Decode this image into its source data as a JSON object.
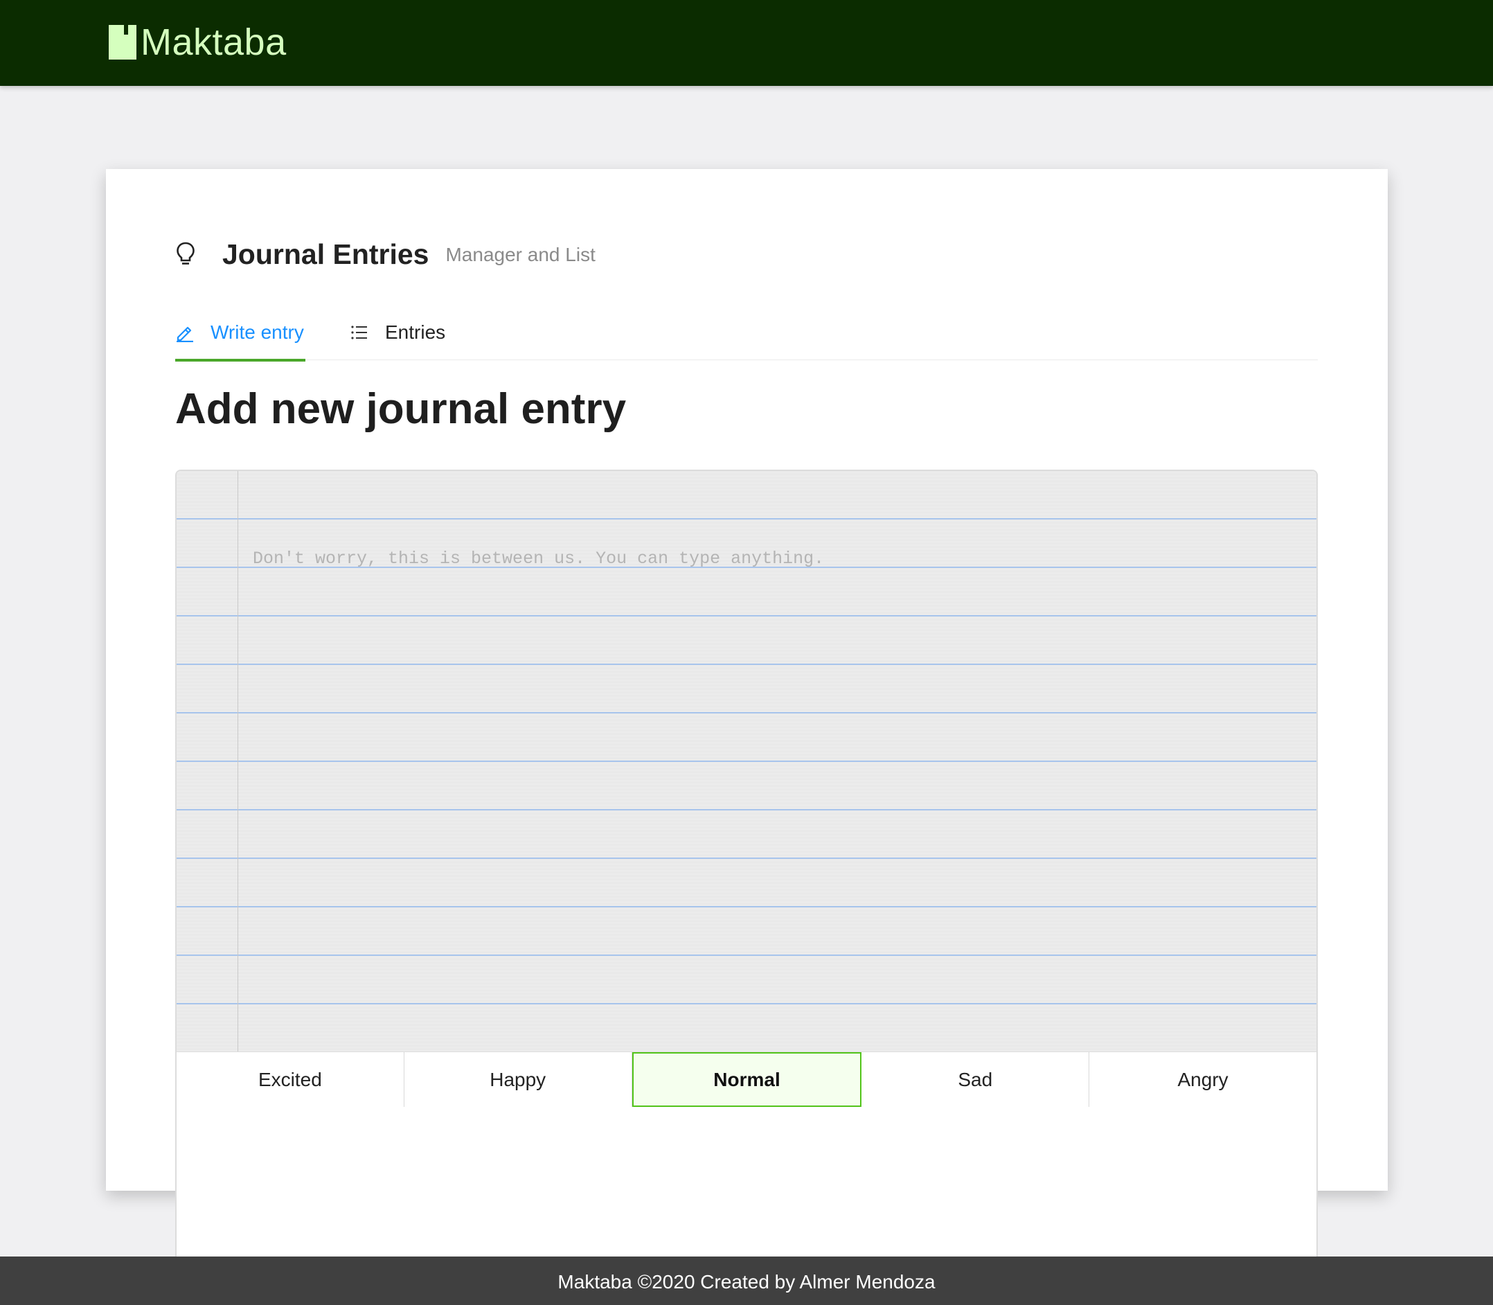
{
  "header": {
    "brand_name": "Maktaba",
    "brand_icon": "book-icon",
    "brand_text_color": "#d5ffbe",
    "background_color": "#0b2c00"
  },
  "page": {
    "title": "Journal Entries",
    "subtitle": "Manager and List",
    "title_icon": "lightbulb-icon"
  },
  "tabs": [
    {
      "label": "Write entry",
      "icon": "edit-pencil-icon",
      "active": true
    },
    {
      "label": "Entries",
      "icon": "list-icon",
      "active": false
    }
  ],
  "form": {
    "title": "Add new journal entry",
    "entry_value": "",
    "entry_placeholder": "Don't worry, this is between us. You can type anything."
  },
  "moods": {
    "options": [
      "Excited",
      "Happy",
      "Normal",
      "Sad",
      "Angry"
    ],
    "selected": "Normal"
  },
  "colors": {
    "accent_blue": "#1890ff",
    "active_tab_underline": "#4aa72a",
    "selected_mood_border": "#52c41a",
    "notebook_rule_line": "#a7c4ec"
  },
  "footer": {
    "text": "Maktaba ©2020 Created by Almer Mendoza"
  }
}
